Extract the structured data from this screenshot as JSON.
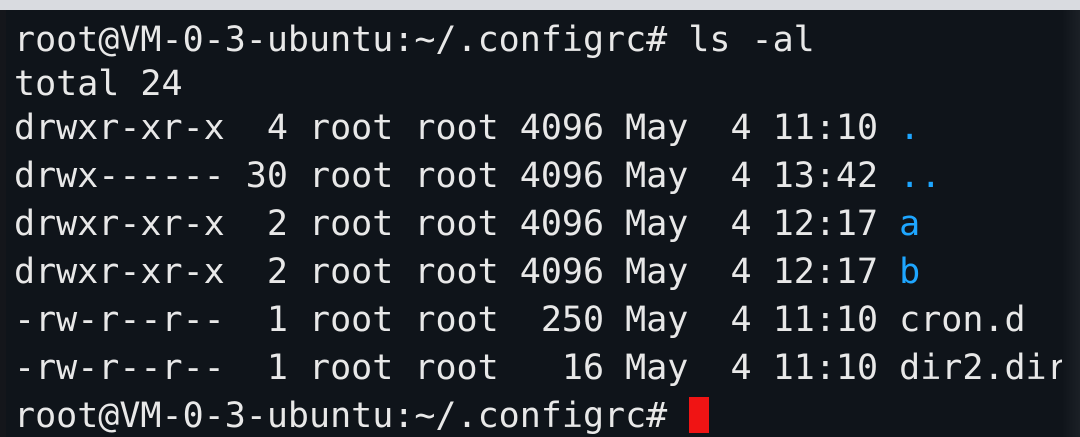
{
  "terminal": {
    "prompt": "root@VM-0-3-ubuntu:~/.configrc#",
    "command": "ls -al",
    "total": "total 24",
    "rows": [
      {
        "perms": "drwxr-xr-x",
        "links": " 4",
        "owner": "root",
        "group": "root",
        "size": "4096",
        "month": "May",
        "day": " 4",
        "time": "11:10",
        "name": "."
      },
      {
        "perms": "drwx------",
        "links": "30",
        "owner": "root",
        "group": "root",
        "size": "4096",
        "month": "May",
        "day": " 4",
        "time": "13:42",
        "name": ".."
      },
      {
        "perms": "drwxr-xr-x",
        "links": " 2",
        "owner": "root",
        "group": "root",
        "size": "4096",
        "month": "May",
        "day": " 4",
        "time": "12:17",
        "name": "a"
      },
      {
        "perms": "drwxr-xr-x",
        "links": " 2",
        "owner": "root",
        "group": "root",
        "size": "4096",
        "month": "May",
        "day": " 4",
        "time": "12:17",
        "name": "b"
      },
      {
        "perms": "-rw-r--r--",
        "links": " 1",
        "owner": "root",
        "group": "root",
        "size": " 250",
        "month": "May",
        "day": " 4",
        "time": "11:10",
        "name": "cron.d"
      },
      {
        "perms": "-rw-r--r--",
        "links": " 1",
        "owner": "root",
        "group": "root",
        "size": "  16",
        "month": "May",
        "day": " 4",
        "time": "11:10",
        "name": "dir2.dir"
      }
    ]
  },
  "colors": {
    "background": "#0f141a",
    "text": "#e8e8e8",
    "directory": "#1ea6ff",
    "cursor": "#f01414"
  }
}
